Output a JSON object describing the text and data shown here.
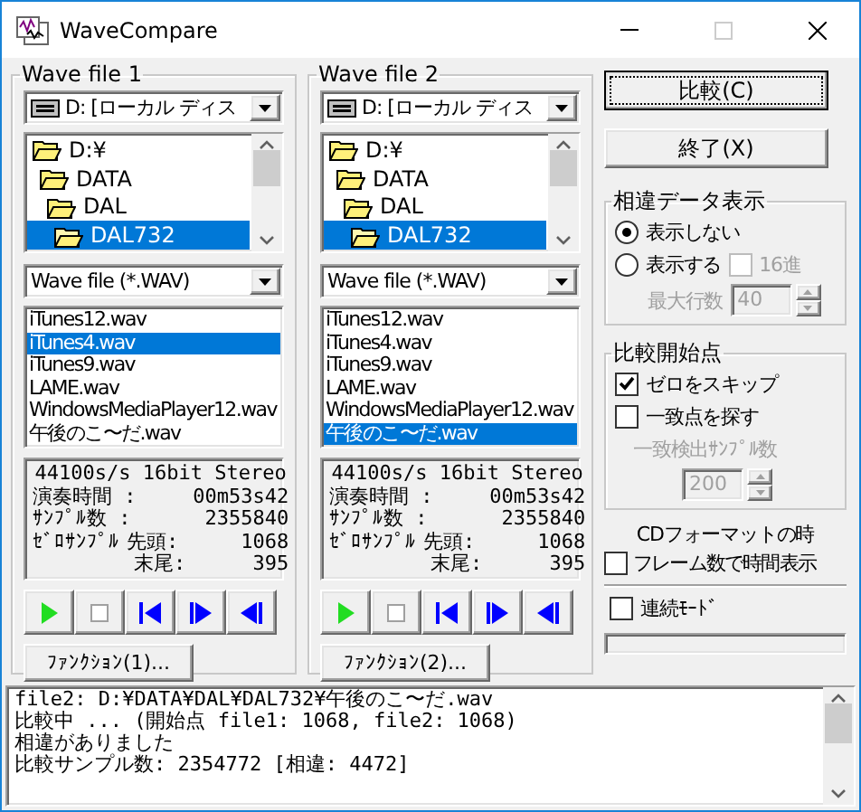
{
  "window": {
    "title": "WaveCompare"
  },
  "wave_files": [
    {
      "title": "Wave file 1",
      "drive": "D: [ローカル ディス",
      "folders": [
        {
          "label": "D:¥",
          "selected": false,
          "children": [
            {
              "label": "DATA",
              "selected": false,
              "children": [
                {
                  "label": "DAL",
                  "selected": false,
                  "children": [
                    {
                      "label": "DAL732",
                      "selected": true
                    }
                  ]
                }
              ]
            }
          ]
        }
      ],
      "filter": "Wave file (*.WAV)",
      "files": [
        {
          "label": "iTunes12.wav",
          "selected": false
        },
        {
          "label": "iTunes4.wav",
          "selected": true
        },
        {
          "label": "iTunes9.wav",
          "selected": false
        },
        {
          "label": "LAME.wav",
          "selected": false
        },
        {
          "label": "WindowsMediaPlayer12.wav",
          "selected": false
        },
        {
          "label": "午後のこ〜だ.wav",
          "selected": false
        }
      ],
      "info": {
        "format": "44100s/s 16bit Stereo",
        "play_time_label": "演奏時間 :",
        "play_time": "00m53s42",
        "samples_label": "ｻﾝﾌﾟﾙ数  :",
        "samples": "2355840",
        "zero_label": "ｾﾞﾛｻﾝﾌﾟﾙ",
        "head_label": "先頭:",
        "head": "1068",
        "tail_label": "末尾:",
        "tail": "395"
      },
      "transport": [
        {
          "kind": "play"
        },
        {
          "kind": "stop"
        },
        {
          "kind": "prev"
        },
        {
          "kind": "next"
        },
        {
          "kind": "end"
        }
      ],
      "function_button": "ﾌｧﾝｸｼｮﾝ(1)..."
    },
    {
      "title": "Wave file 2",
      "drive": "D: [ローカル ディス",
      "folders": [
        {
          "label": "D:¥",
          "selected": false,
          "children": [
            {
              "label": "DATA",
              "selected": false,
              "children": [
                {
                  "label": "DAL",
                  "selected": false,
                  "children": [
                    {
                      "label": "DAL732",
                      "selected": true
                    }
                  ]
                }
              ]
            }
          ]
        }
      ],
      "filter": "Wave file (*.WAV)",
      "files": [
        {
          "label": "iTunes12.wav",
          "selected": false
        },
        {
          "label": "iTunes4.wav",
          "selected": false
        },
        {
          "label": "iTunes9.wav",
          "selected": false
        },
        {
          "label": "LAME.wav",
          "selected": false
        },
        {
          "label": "WindowsMediaPlayer12.wav",
          "selected": false
        },
        {
          "label": "午後のこ〜だ.wav",
          "selected": true
        }
      ],
      "info": {
        "format": "44100s/s 16bit Stereo",
        "play_time_label": "演奏時間 :",
        "play_time": "00m53s42",
        "samples_label": "ｻﾝﾌﾟﾙ数  :",
        "samples": "2355840",
        "zero_label": "ｾﾞﾛｻﾝﾌﾟﾙ",
        "head_label": "先頭:",
        "head": "1068",
        "tail_label": "末尾:",
        "tail": "395"
      },
      "transport": [
        {
          "kind": "play"
        },
        {
          "kind": "stop"
        },
        {
          "kind": "prev"
        },
        {
          "kind": "next"
        },
        {
          "kind": "end"
        }
      ],
      "function_button": "ﾌｧﾝｸｼｮﾝ(2)..."
    }
  ],
  "buttons": [
    {
      "label": "比較(C)",
      "focused": true
    },
    {
      "label": "終了(X)",
      "focused": false
    }
  ],
  "diff_display": {
    "title": "相違データ表示",
    "options": [
      {
        "label": "表示しない",
        "selected": true
      },
      {
        "label": "表示する",
        "selected": false
      }
    ],
    "hex": {
      "label": "16進",
      "checked": false,
      "disabled": true
    },
    "max_rows": {
      "label": "最大行数",
      "value": "40",
      "disabled": true
    }
  },
  "start_point": {
    "title": "比較開始点",
    "skip_zero": {
      "label": "ゼロをスキップ",
      "checked": true
    },
    "find_match": {
      "label": "一致点を探す",
      "checked": false
    },
    "match_samples": {
      "label": "一致検出ｻﾝﾌﾟﾙ数",
      "value": "200",
      "disabled": true
    }
  },
  "cd_format": {
    "caption": "CDフォーマットの時",
    "label": "フレーム数で時間表示",
    "checked": false
  },
  "continuous": {
    "label": "連続ﾓｰﾄﾞ",
    "checked": false
  },
  "log": [
    "file2: D:¥DATA¥DAL¥DAL732¥午後のこ〜だ.wav",
    "比較中 ...  (開始点  file1: 1068,  file2: 1068)",
    "相違がありました",
    "比較サンプル数: 2354772  [相違: 4472]"
  ]
}
